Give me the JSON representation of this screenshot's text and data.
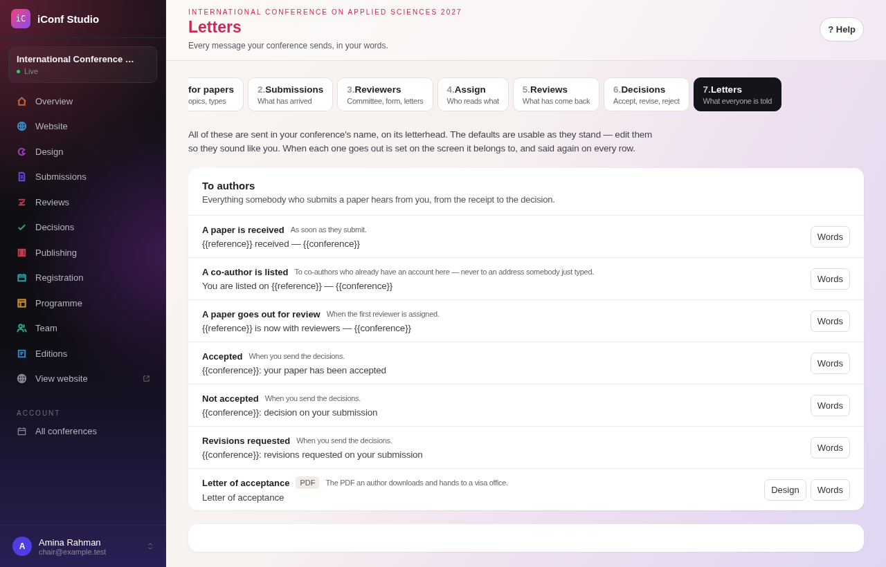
{
  "app": {
    "logo": "iC",
    "name": "iConf Studio"
  },
  "conference": {
    "name": "International Conference …",
    "status": "Live"
  },
  "nav": [
    {
      "label": "Overview",
      "color": "#c2643a",
      "external": false
    },
    {
      "label": "Website",
      "color": "#3a86c2",
      "external": false
    },
    {
      "label": "Design",
      "color": "#9b3ac2",
      "external": false
    },
    {
      "label": "Submissions",
      "color": "#5a4ad6",
      "external": false
    },
    {
      "label": "Reviews",
      "color": "#c23a4e",
      "external": false
    },
    {
      "label": "Decisions",
      "color": "#2aa36b",
      "external": false
    },
    {
      "label": "Publishing",
      "color": "#c23a4e",
      "external": false
    },
    {
      "label": "Registration",
      "color": "#2a9aa3",
      "external": false
    },
    {
      "label": "Programme",
      "color": "#c2902a",
      "external": false
    },
    {
      "label": "Team",
      "color": "#2aa38c",
      "external": false
    },
    {
      "label": "Editions",
      "color": "#2a86c2",
      "external": false
    },
    {
      "label": "View website",
      "color": "#8a8a90",
      "external": true
    }
  ],
  "account": {
    "heading": "ACCOUNT",
    "items": [
      {
        "label": "All conferences"
      }
    ]
  },
  "user": {
    "initial": "A",
    "name": "Amina Rahman",
    "email": "chair@example.test"
  },
  "header": {
    "eyebrow": "INTERNATIONAL CONFERENCE ON APPLIED SCIENCES 2027",
    "title": "Letters",
    "subtitle": "Every message your conference sends, in your words.",
    "help": "? Help"
  },
  "steps": [
    {
      "title": "for papers",
      "subtitle": "opics, types",
      "selected": false
    },
    {
      "number": "2.",
      "title": "Submissions",
      "subtitle": "What has arrived",
      "selected": false
    },
    {
      "number": "3.",
      "title": "Reviewers",
      "subtitle": "Committee, form, letters",
      "selected": false
    },
    {
      "number": "4.",
      "title": "Assign",
      "subtitle": "Who reads what",
      "selected": false
    },
    {
      "number": "5.",
      "title": "Reviews",
      "subtitle": "What has come back",
      "selected": false
    },
    {
      "number": "6.",
      "title": "Decisions",
      "subtitle": "Accept, revise, reject",
      "selected": false
    },
    {
      "number": "7.",
      "title": "Letters",
      "subtitle": "What everyone is told",
      "selected": true
    }
  ],
  "intro": "All of these are sent in your conference's name, on its letterhead. The defaults are usable as they stand — edit them so they sound like you. When each one goes out is set on the screen it belongs to, and said again on every row.",
  "card": {
    "title": "To authors",
    "subtitle": "Everything somebody who submits a paper hears from you, from the receipt to the decision.",
    "rows": [
      {
        "title": "A paper is received",
        "note": "As soon as they submit.",
        "subject": "{{reference}} received — {{conference}}",
        "buttons": [
          "Words"
        ]
      },
      {
        "title": "A co-author is listed",
        "note": "To co-authors who already have an account here — never to an address somebody just typed.",
        "subject": "You are listed on {{reference}} — {{conference}}",
        "buttons": [
          "Words"
        ]
      },
      {
        "title": "A paper goes out for review",
        "note": "When the first reviewer is assigned.",
        "subject": "{{reference}} is now with reviewers — {{conference}}",
        "buttons": [
          "Words"
        ]
      },
      {
        "title": "Accepted",
        "note": "When you send the decisions.",
        "subject": "{{conference}}: your paper has been accepted",
        "buttons": [
          "Words"
        ]
      },
      {
        "title": "Not accepted",
        "note": "When you send the decisions.",
        "subject": "{{conference}}: decision on your submission",
        "buttons": [
          "Words"
        ]
      },
      {
        "title": "Revisions requested",
        "note": "When you send the decisions.",
        "subject": "{{conference}}: revisions requested on your submission",
        "buttons": [
          "Words"
        ]
      },
      {
        "title": "Letter of acceptance",
        "tag": "PDF",
        "note": "The PDF an author downloads and hands to a visa office.",
        "subject": "Letter of acceptance",
        "buttons": [
          "Design",
          "Words"
        ]
      }
    ]
  }
}
